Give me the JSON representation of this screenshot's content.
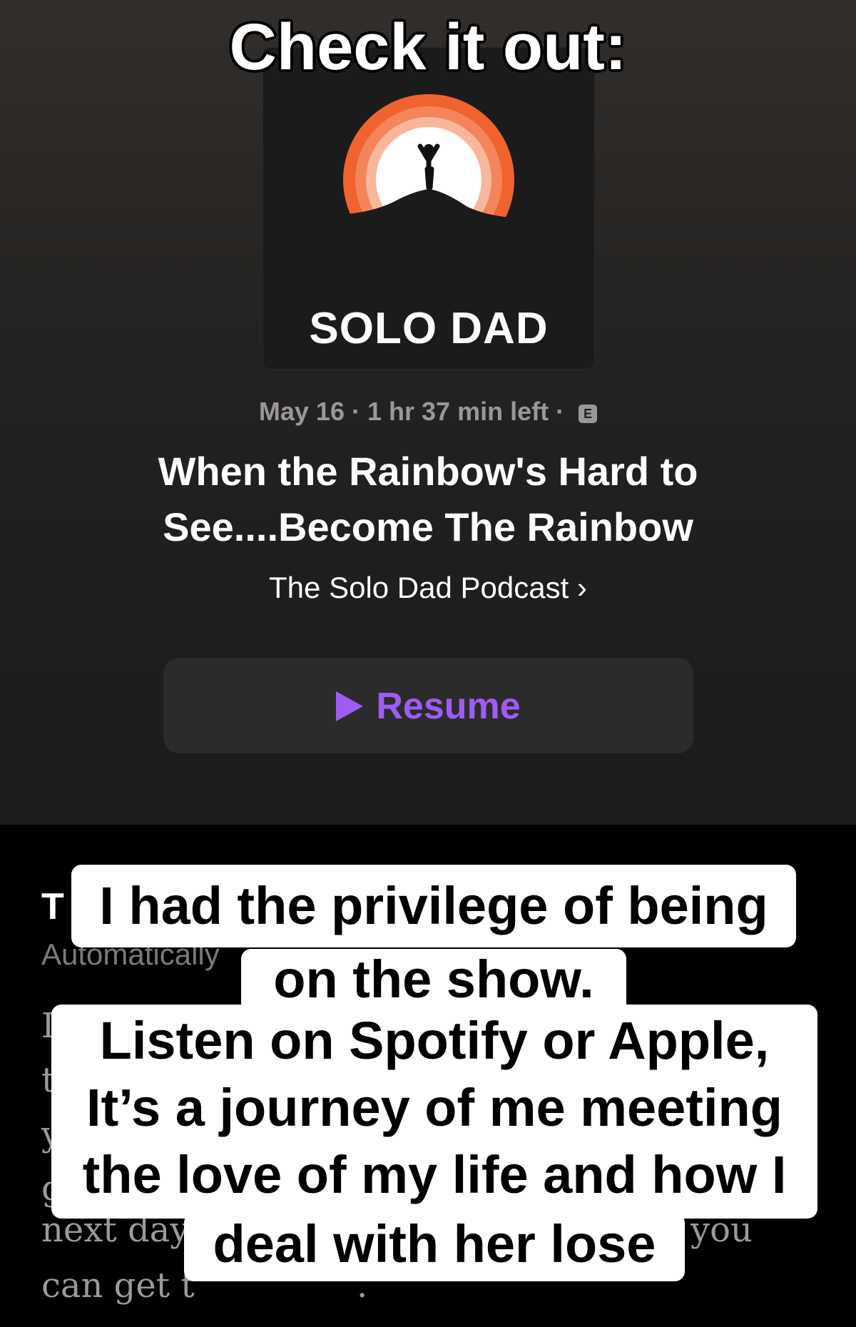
{
  "overlay_caption_top": "Check it out:",
  "artwork": {
    "title": "SOLO DAD"
  },
  "episode": {
    "date": "May 16",
    "separator": "·",
    "remaining": "1 hr 37 min left",
    "explicit_badge": "E",
    "title": "When the Rainbow's Hard to See....Become The Rainbow",
    "podcast": "The Solo Dad Podcast",
    "podcast_chevron": "›"
  },
  "resume_button": {
    "label": "Resume",
    "icon": "play-icon"
  },
  "transcript": {
    "heading_fragment": "T",
    "sub_fragment": "Automatically",
    "line_fragments": [
      "I",
      "t",
      "y",
      "g",
      "next day",
      "you",
      "can get t",
      "."
    ]
  },
  "overlay_captions": [
    "I had the privilege of being",
    "on the show.",
    "Listen on Spotify or Apple,",
    "It’s a journey of me meeting",
    "the love of my life and how I",
    "deal with her lose"
  ],
  "colors": {
    "accent": "#9e5cf5",
    "logo_orange": "#f0632e"
  }
}
